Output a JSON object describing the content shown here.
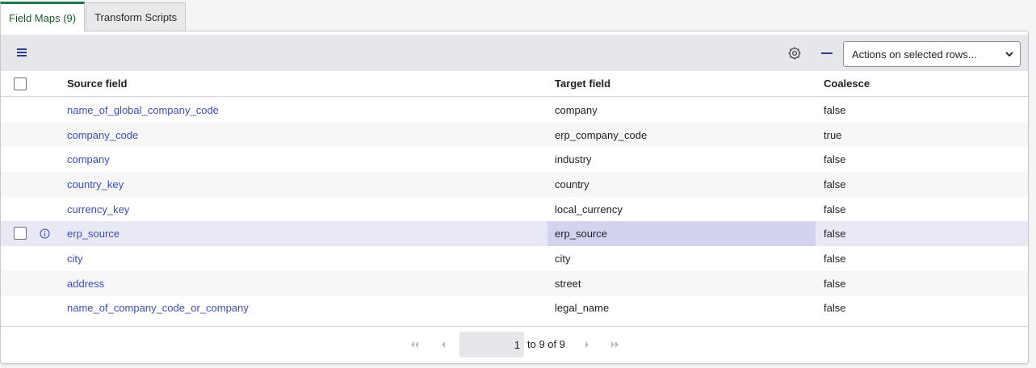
{
  "tabs": [
    {
      "label": "Field Maps (9)",
      "active": true
    },
    {
      "label": "Transform Scripts",
      "active": false
    }
  ],
  "toolbar": {
    "actions_label": "Actions on selected rows..."
  },
  "table": {
    "headers": {
      "source": "Source field",
      "target": "Target field",
      "coalesce": "Coalesce"
    },
    "rows": [
      {
        "source": "name_of_global_company_code",
        "target": "company",
        "coalesce": "false"
      },
      {
        "source": "company_code",
        "target": "erp_company_code",
        "coalesce": "true"
      },
      {
        "source": "company",
        "target": "industry",
        "coalesce": "false"
      },
      {
        "source": "country_key",
        "target": "country",
        "coalesce": "false"
      },
      {
        "source": "currency_key",
        "target": "local_currency",
        "coalesce": "false"
      },
      {
        "source": "erp_source",
        "target": "erp_source",
        "coalesce": "false",
        "hovered": true
      },
      {
        "source": "city",
        "target": "city",
        "coalesce": "false"
      },
      {
        "source": "address",
        "target": "street",
        "coalesce": "false"
      },
      {
        "source": "name_of_company_code_or_company",
        "target": "legal_name",
        "coalesce": "false"
      }
    ]
  },
  "pagination": {
    "current_page": "1",
    "range_text": "to 9 of 9"
  },
  "colors": {
    "link": "#3b4dbf",
    "active_tab_accent": "#1d7a4b",
    "toolbar_bg": "#e6e7eb",
    "hover_row": "#e9e9f6",
    "hover_cell": "#d3d3ef"
  },
  "icons": [
    "list-menu-icon",
    "gear-icon",
    "minus-icon",
    "chevron-down-icon",
    "info-icon",
    "first-page-icon",
    "previous-page-icon",
    "next-page-icon",
    "last-page-icon"
  ]
}
